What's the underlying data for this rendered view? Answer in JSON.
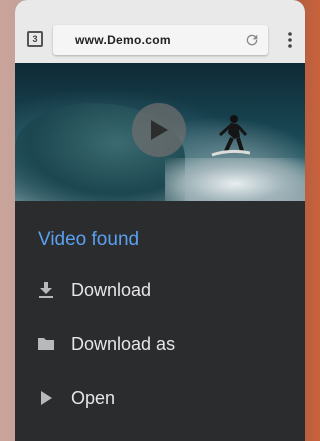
{
  "browser": {
    "tab_count": "3",
    "url": "www.Demo.com"
  },
  "sheet": {
    "title": "Video found",
    "actions": [
      {
        "label": "Download",
        "icon": "download-icon"
      },
      {
        "label": "Download as",
        "icon": "folder-icon"
      },
      {
        "label": "Open",
        "icon": "play-icon"
      }
    ]
  },
  "colors": {
    "accent": "#5aa0f0",
    "sheet_bg": "#2b2c2e",
    "toolbar_bg": "#e9e9e9"
  }
}
